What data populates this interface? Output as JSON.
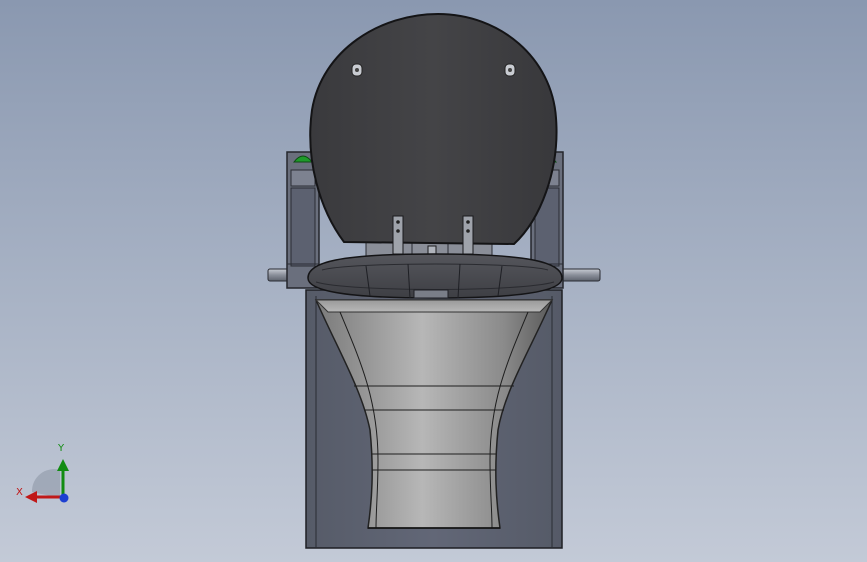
{
  "viewport": {
    "background_top": "#8a98b0",
    "background_bottom": "#c3cad7"
  },
  "model": {
    "parts": [
      "seat-lid",
      "seat-ring",
      "bowl-cone",
      "base-body",
      "left-hinge-bracket",
      "right-hinge-bracket",
      "left-pivot-pin",
      "right-pivot-pin"
    ],
    "colors": {
      "lid": "#3f3f42",
      "ring": "#4a4b50",
      "base": "#5d6270",
      "bracket": "#6a6f7d",
      "cone_light": "#b2b2b2",
      "cone_dark": "#6a6a6a",
      "cap_green": "#1e9a2a"
    }
  },
  "triad": {
    "x_label": "X",
    "y_label": "Y",
    "x_color": "#c01818",
    "y_color": "#128c12",
    "z_color": "#1d3fd1"
  }
}
